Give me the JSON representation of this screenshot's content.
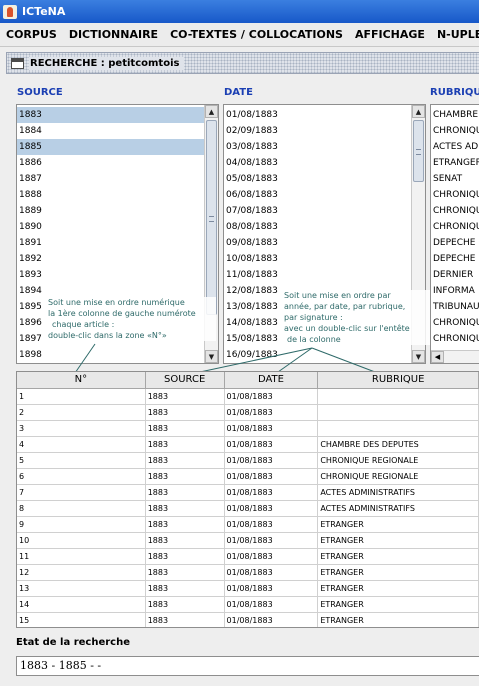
{
  "window": {
    "title": "ICTeNA"
  },
  "menu": [
    "CORPUS",
    "DICTIONNAIRE",
    "CO-TEXTES / COLLOCATIONS",
    "AFFICHAGE",
    "N-UPLETS"
  ],
  "panel": {
    "title": "RECHERCHE : petitcomtois"
  },
  "source": {
    "label": "SOURCE",
    "items": [
      "1883",
      "1884",
      "1885",
      "1886",
      "1887",
      "1888",
      "1889",
      "1890",
      "1891",
      "1892",
      "1893",
      "1894",
      "1895",
      "1896",
      "1897",
      "1898"
    ],
    "selected": [
      "1883",
      "1885"
    ]
  },
  "date": {
    "label": "DATE",
    "items": [
      "01/08/1883",
      "02/09/1883",
      "03/08/1883",
      "04/08/1883",
      "05/08/1883",
      "06/08/1883",
      "07/08/1883",
      "08/08/1883",
      "09/08/1883",
      "10/08/1883",
      "11/08/1883",
      "12/08/1883",
      "13/08/1883",
      "14/08/1883",
      "15/08/1883",
      "16/09/1883"
    ]
  },
  "rubrique": {
    "label": "RUBRIQUE",
    "items": [
      "CHAMBRE",
      "CHRONIQU",
      "ACTES AD",
      "ETRANGER",
      "SENAT",
      "CHRONIQU",
      "CHRONIQU",
      "CHRONIQU",
      "DEPECHE",
      "DEPECHE",
      "DERNIER",
      "INFORMA",
      "TRIBUNAU",
      "CHRONIQU",
      "CHRONIQU"
    ]
  },
  "annotations": {
    "left": [
      "Soit une mise en ordre numérique",
      "la 1ère colonne de gauche numérote",
      "chaque article :",
      "double-clic dans la zone «N°»"
    ],
    "right": [
      "Soit une mise en ordre par",
      "année, par date, par rubrique,",
      "par signature  :",
      "avec un double-clic sur l'entête",
      "de la colonne"
    ]
  },
  "table": {
    "headers": [
      "N°",
      "SOURCE",
      "DATE",
      "RUBRIQUE"
    ],
    "rows": [
      [
        "1",
        "1883",
        "01/08/1883",
        ""
      ],
      [
        "2",
        "1883",
        "01/08/1883",
        ""
      ],
      [
        "3",
        "1883",
        "01/08/1883",
        ""
      ],
      [
        "4",
        "1883",
        "01/08/1883",
        "CHAMBRE DES DEPUTES"
      ],
      [
        "5",
        "1883",
        "01/08/1883",
        "CHRONIQUE REGIONALE"
      ],
      [
        "6",
        "1883",
        "01/08/1883",
        "CHRONIQUE REGIONALE"
      ],
      [
        "7",
        "1883",
        "01/08/1883",
        "ACTES ADMINISTRATIFS"
      ],
      [
        "8",
        "1883",
        "01/08/1883",
        "ACTES ADMINISTRATIFS"
      ],
      [
        "9",
        "1883",
        "01/08/1883",
        "ETRANGER"
      ],
      [
        "10",
        "1883",
        "01/08/1883",
        "ETRANGER"
      ],
      [
        "11",
        "1883",
        "01/08/1883",
        "ETRANGER"
      ],
      [
        "12",
        "1883",
        "01/08/1883",
        "ETRANGER"
      ],
      [
        "13",
        "1883",
        "01/08/1883",
        "ETRANGER"
      ],
      [
        "14",
        "1883",
        "01/08/1883",
        "ETRANGER"
      ],
      [
        "15",
        "1883",
        "01/08/1883",
        "ETRANGER"
      ]
    ]
  },
  "status": {
    "label": "Etat de la recherche",
    "value": "1883 - 1885 - -"
  },
  "colors": {
    "title_bar": "#1758c9",
    "label_blue": "#1b3fb3",
    "selection": "#b8cfe5",
    "annotation": "#2e6a69"
  }
}
